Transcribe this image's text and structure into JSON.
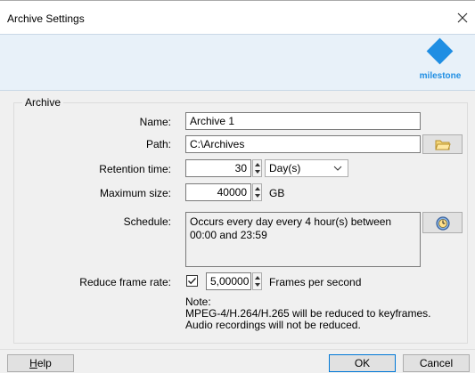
{
  "window": {
    "title": "Archive Settings",
    "close_icon": "close-icon"
  },
  "brand": {
    "name": "milestone",
    "logo_color": "#1f8ee3"
  },
  "group": {
    "title": "Archive"
  },
  "name": {
    "label": "Name:",
    "value": "Archive 1"
  },
  "path": {
    "label": "Path:",
    "value": "C:\\Archives",
    "browse_icon": "folder-icon"
  },
  "retention": {
    "label": "Retention time:",
    "value": "30",
    "unit": "Day(s)"
  },
  "max_size": {
    "label": "Maximum size:",
    "value": "40000",
    "unit": "GB"
  },
  "schedule": {
    "label": "Schedule:",
    "text": "Occurs every day every 4 hour(s) between 00:00 and 23:59",
    "button_icon": "schedule-icon"
  },
  "frame_rate": {
    "label": "Reduce frame rate:",
    "checked": true,
    "value": "5,00000",
    "unit": "Frames per second"
  },
  "note": {
    "title": "Note:",
    "line1": "MPEG-4/H.264/H.265 will be reduced to keyframes.",
    "line2": "Audio recordings will not be reduced."
  },
  "footer": {
    "help_prefix": "",
    "help_underline": "H",
    "help_rest": "elp",
    "ok": "OK",
    "cancel": "Cancel"
  }
}
